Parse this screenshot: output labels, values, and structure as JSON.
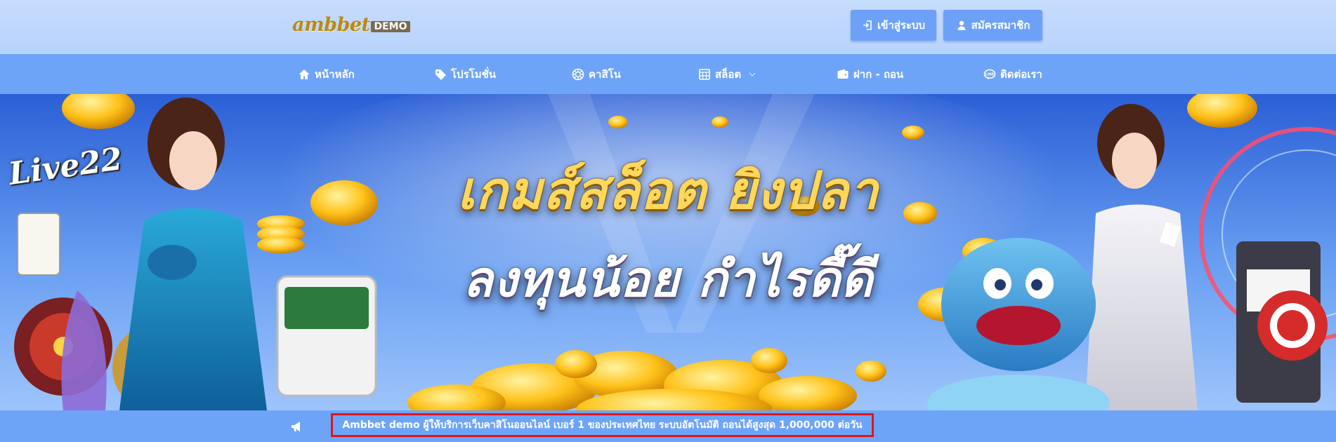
{
  "header": {
    "logo_main": "ambbet",
    "logo_sub": "DEMO",
    "login_label": "เข้าสู่ระบบ",
    "register_label": "สมัครสมาชิก",
    "login_icon": "sign-in-icon",
    "register_icon": "user-icon"
  },
  "nav": {
    "items": [
      {
        "label": "หน้าหลัก",
        "icon": "home-icon"
      },
      {
        "label": "โปรโมชั่น",
        "icon": "tag-icon"
      },
      {
        "label": "คาสิโน",
        "icon": "casino-chip-icon"
      },
      {
        "label": "สล็อต",
        "icon": "slot-machine-icon",
        "dropdown": true
      },
      {
        "label": "ฝาก - ถอน",
        "icon": "wallet-icon"
      },
      {
        "label": "ติดต่อเรา",
        "icon": "line-chat-icon"
      }
    ]
  },
  "banner": {
    "headline_line1": "เกมส์สล็อต ยิงปลา",
    "headline_line2": "ลงทุนน้อย กำไรดี๊ดี",
    "brand_badge": "Live22"
  },
  "notice": {
    "icon": "megaphone-icon",
    "text": "Ambbet demo ผู้ให้บริการเว็บคาสิโนออนไลน์ เบอร์ 1 ของประเทศไทย ระบบอัตโนมัติ ถอนได้สูงสุด 1,000,000 ต่อวัน"
  },
  "colors": {
    "header_bg": "#c6dcfd",
    "nav_bg": "#6ea4f8",
    "button_bg": "#6da1f7",
    "notice_border": "#e0151b",
    "headline_gold": "#ffd75a"
  }
}
